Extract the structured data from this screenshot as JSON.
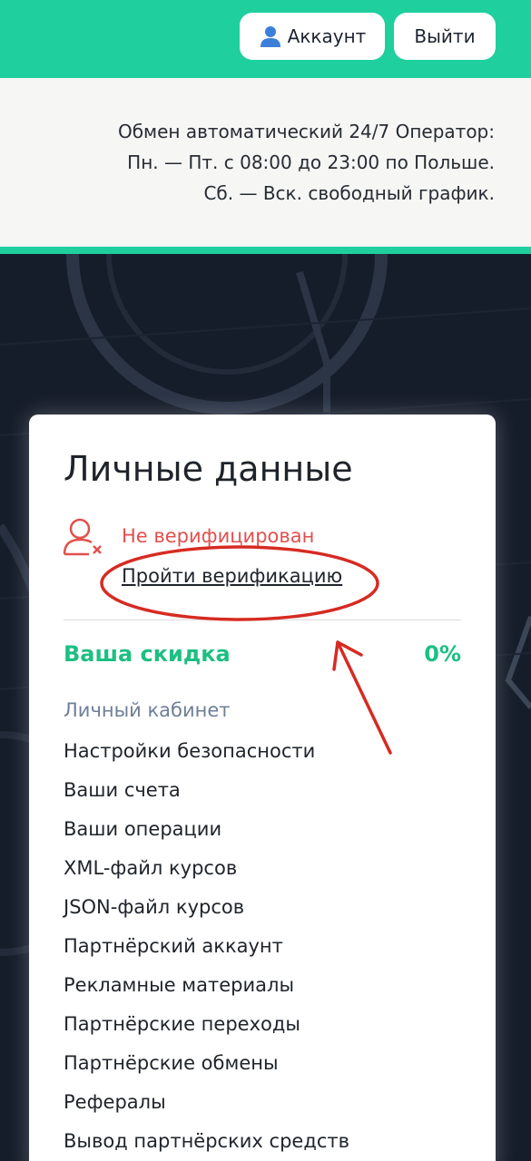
{
  "header": {
    "account_label": "Аккаунт",
    "logout_label": "Выйти"
  },
  "info": {
    "lines": [
      "Обмен автоматический 24/7 Оператор:",
      "Пн. — Пт. с 08:00 до 23:00 по Польше.",
      "Сб. — Вск. свободный график."
    ]
  },
  "card": {
    "title": "Личные данные",
    "status_text": "Не верифицирован",
    "verify_link": "Пройти верификацию",
    "discount_label": "Ваша скидка",
    "discount_value": "0%",
    "menu_header": "Личный кабинет",
    "menu_items": [
      "Настройки безопасности",
      "Ваши счета",
      "Ваши операции",
      "XML-файл курсов",
      "JSON-файл курсов",
      "Партнёрский аккаунт",
      "Рекламные материалы",
      "Партнёрские переходы",
      "Партнёрские обмены",
      "Рефералы",
      "Вывод партнёрских средств"
    ]
  },
  "colors": {
    "brand_teal": "#1fcf9e",
    "discount_green": "#1dbf82",
    "warning_red": "#e2504d",
    "annotation_red": "#d62b22",
    "dark_bg": "#161d2a"
  },
  "icons": {
    "account": "user-icon",
    "status": "user-unverified-icon"
  }
}
